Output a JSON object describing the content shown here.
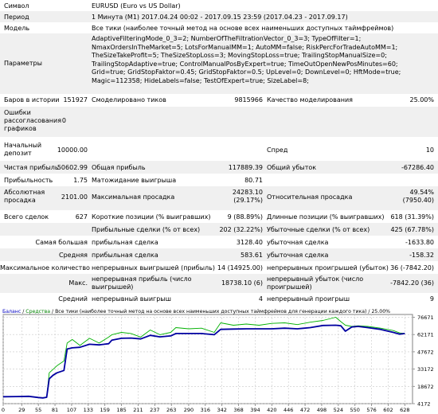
{
  "header": {
    "symbol_label": "Символ",
    "symbol_value": "EURUSD (Euro vs US Dollar)",
    "period_label": "Период",
    "period_value": "1 Минута (M1) 2017.04.24 00:02 - 2017.09.15 23:59 (2017.04.23 - 2017.09.17)",
    "model_label": "Модель",
    "model_value": "Все тики (наиболее точный метод на основе всех наименьших доступных таймфреймов)",
    "params_label": "Параметры",
    "params_value": "AdaptiveFilteringMode_0_3=2; NumberOfTheFiltrationVector_0_3=3; TypeOfFilter=1; NmaxOrdersInTheMarket=5; LotsForManualMM=1; AutoMM=false; RiskPercForTradeAutoMM=1; TheSizeTakeProfit=5; TheSizeStopLoss=3; MovingStopLoss=true; TrailingStopManualSize=0; TrailingStopAdaptive=true; ControlManualPosByExpert=true; TimeOutOpenNewPosMinutes=60; Grid=true; GridStopFaktor=0.45; GridStopFaktor=0.5; UpLevel=0; DownLevel=0; HftMode=true; Magic=112358; HideLabels=false; TestOfExpert=true; SizeLabel=8;"
  },
  "stats": {
    "bars_label": "Баров в истории",
    "bars_value": "151927",
    "ticks_label": "Смоделировано тиков",
    "ticks_value": "9815966",
    "quality_label": "Качество моделирования",
    "quality_value": "25.00%",
    "errors_label": "Ошибки рассогласования графиков",
    "errors_value": "0",
    "deposit_label": "Начальный депозит",
    "deposit_value": "10000.00",
    "spread_label": "Спред",
    "spread_value": "10",
    "net_label": "Чистая прибыль",
    "net_value": "50602.99",
    "gross_profit_label": "Общая прибыль",
    "gross_profit_value": "117889.39",
    "gross_loss_label": "Общий убыток",
    "gross_loss_value": "-67286.40",
    "pf_label": "Прибыльность",
    "pf_value": "1.75",
    "expected_label": "Матожидание выигрыша",
    "expected_value": "80.71",
    "abs_dd_label": "Абсолютная просадка",
    "abs_dd_value": "2101.00",
    "max_dd_label": "Максимальная просадка",
    "max_dd_value": "24283.10 (29.17%)",
    "rel_dd_label": "Относительная просадка",
    "rel_dd_value": "49.54% (7950.40)",
    "total_label": "Всего сделок",
    "total_value": "627",
    "short_label": "Короткие позиции (% выигравших)",
    "short_value": "9 (88.89%)",
    "long_label": "Длинные позиции (% выигравших)",
    "long_value": "618 (31.39%)",
    "profit_trades_label": "Прибыльные сделки (% от всех)",
    "profit_trades_value": "202 (32.22%)",
    "loss_trades_label": "Убыточные сделки (% от всех)",
    "loss_trades_value": "425 (67.78%)",
    "largest_label": "Самая большая",
    "largest_profit_label": "прибыльная сделка",
    "largest_profit_value": "3128.40",
    "largest_loss_label": "убыточная сделка",
    "largest_loss_value": "-1633.80",
    "average_label": "Средняя",
    "average_profit_label": "прибыльная сделка",
    "average_profit_value": "583.61",
    "average_loss_label": "убыточная сделка",
    "average_loss_value": "-158.32",
    "maxcount_label": "Максимальное количество",
    "cons_wins_label": "непрерывных выигрышей (прибыль)",
    "cons_wins_value": "14 (14925.00)",
    "cons_losses_label": "непрерывных проигрышей (убыток)",
    "cons_losses_value": "36 (-7842.20)",
    "max_label": "Макс.",
    "cons_profit_label": "непрерывная прибыль (число выигрышей)",
    "cons_profit_value": "18738.10 (6)",
    "cons_loss_label": "непрерывный убыток (число проигрышей)",
    "cons_loss_value": "-7842.20 (36)",
    "avg_cons_label": "Средний",
    "avg_cons_wins_label": "непрерывный выигрыш",
    "avg_cons_wins_value": "4",
    "avg_cons_losses_label": "непрерывный проигрыш",
    "avg_cons_losses_value": "9"
  },
  "chart_header": {
    "balance": "Баланс",
    "sep1": " / ",
    "equity": "Средства",
    "rest": " / Все тики (наиболее точный метод на основе всех наименьших доступных таймфреймов для генерации каждого тика) / 25.00%"
  },
  "colors": {
    "balance": "#0000a0",
    "equity": "#00b000",
    "header_blue": "#0000c0",
    "header_green": "#008000"
  },
  "chart_data": {
    "type": "line",
    "x_ticks": [
      "0",
      "29",
      "55",
      "81",
      "107",
      "133",
      "159",
      "185",
      "211",
      "237",
      "263",
      "290",
      "316",
      "342",
      "368",
      "394",
      "420",
      "446",
      "472",
      "498",
      "524",
      "550",
      "576",
      "602",
      "628"
    ],
    "y_ticks": [
      "76671",
      "62171",
      "47672",
      "33172",
      "18672",
      "4172"
    ],
    "ylim": [
      4172,
      79000
    ],
    "xlim": [
      0,
      640
    ],
    "series": [
      {
        "name": "Баланс",
        "x": [
          0,
          20,
          40,
          55,
          62,
          68,
          72,
          78,
          84,
          95,
          100,
          108,
          120,
          135,
          150,
          165,
          170,
          185,
          200,
          215,
          230,
          245,
          262,
          270,
          290,
          310,
          330,
          340,
          360,
          380,
          400,
          420,
          440,
          460,
          480,
          500,
          520,
          528,
          535,
          545,
          555,
          570,
          590,
          610,
          620,
          628
        ],
        "y": [
          10000,
          10100,
          10300,
          9300,
          9000,
          9500,
          25000,
          28000,
          30000,
          32000,
          50000,
          51000,
          51500,
          54000,
          53500,
          54500,
          57500,
          59000,
          59200,
          58500,
          61500,
          60200,
          61000,
          63000,
          63000,
          63000,
          62000,
          66500,
          66800,
          67000,
          67000,
          67000,
          67500,
          67000,
          68000,
          69800,
          70000,
          69500,
          65000,
          68500,
          69000,
          68000,
          66500,
          64000,
          62500,
          63000
        ]
      },
      {
        "name": "Средства",
        "x": [
          0,
          20,
          40,
          55,
          62,
          68,
          72,
          78,
          84,
          95,
          100,
          108,
          120,
          135,
          150,
          165,
          170,
          185,
          200,
          215,
          230,
          245,
          262,
          270,
          290,
          310,
          330,
          340,
          360,
          380,
          400,
          420,
          440,
          460,
          480,
          500,
          520,
          528,
          535,
          545,
          555,
          570,
          590,
          610,
          620,
          628
        ],
        "y": [
          10000,
          10100,
          10300,
          9300,
          9000,
          9500,
          30000,
          33000,
          36000,
          40000,
          55000,
          58000,
          53000,
          59000,
          55000,
          60000,
          62000,
          64000,
          63000,
          60000,
          66000,
          62000,
          64000,
          68000,
          67000,
          67500,
          64000,
          72000,
          70000,
          71000,
          70000,
          71500,
          72000,
          70500,
          72500,
          74000,
          76671,
          73000,
          70000,
          69000,
          69500,
          69000,
          67500,
          65500,
          63500,
          63000
        ]
      }
    ]
  }
}
